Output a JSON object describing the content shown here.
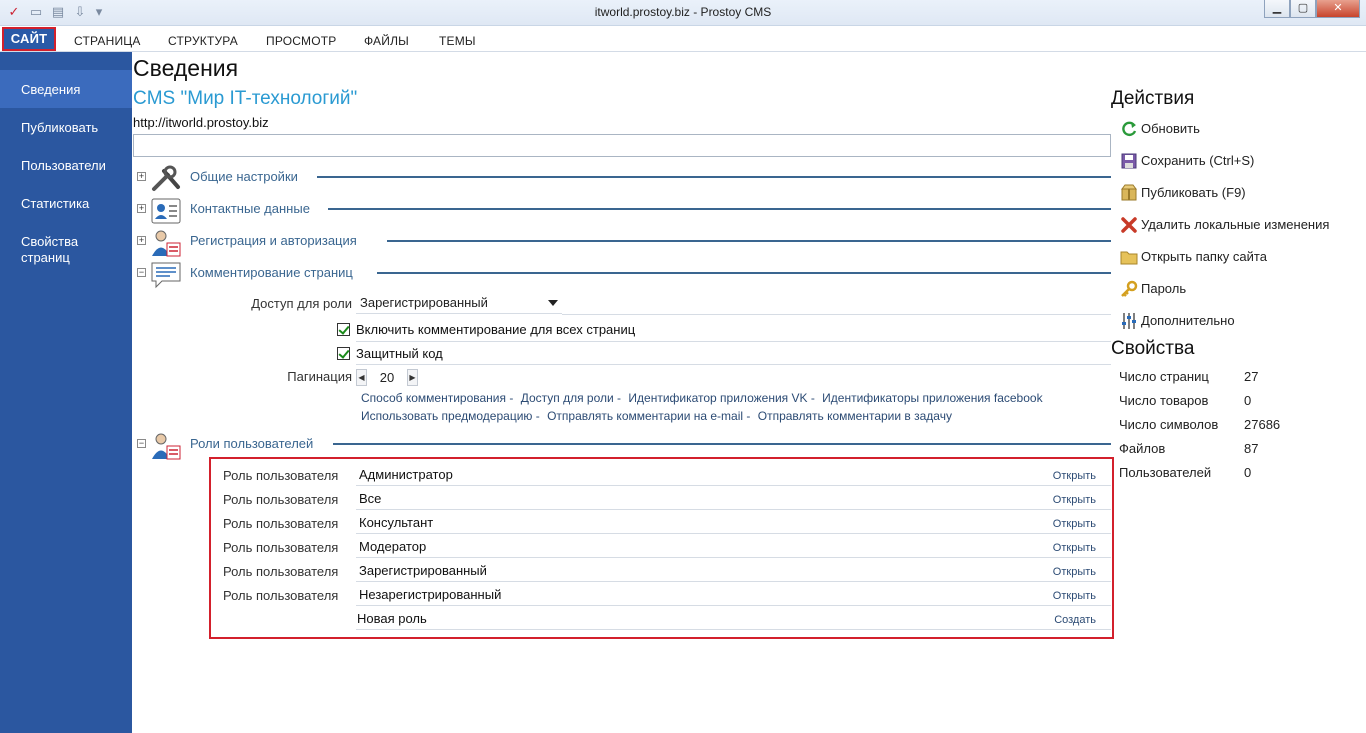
{
  "window": {
    "title": "itworld.prostoy.biz - Prostoy CMS"
  },
  "menu": [
    "САЙТ",
    "СТРАНИЦА",
    "СТРУКТУРА",
    "ПРОСМОТР",
    "ФАЙЛЫ",
    "ТЕМЫ"
  ],
  "sidebar": [
    "Сведения",
    "Публиковать",
    "Пользователи",
    "Статистика",
    "Свойства страниц"
  ],
  "main": {
    "title": "Сведения",
    "site_name": "CMS \"Мир IT-технологий\"",
    "site_url": "http://itworld.prostoy.biz",
    "sections": [
      "Общие настройки",
      "Контактные данные",
      "Регистрация и авторизация",
      "Комментирование страниц",
      "Роли пользователей"
    ],
    "comments": {
      "role_access_label": "Доступ для роли",
      "role_access_value": "Зарегистрированный",
      "enable_all": "Включить комментирование для всех страниц",
      "captcha": "Защитный код",
      "pagination_label": "Пагинация",
      "pagination_value": "20",
      "links_row1": [
        "Способ комментирования -",
        "Доступ для роли -",
        "Идентификатор приложения VK -",
        "Идентификаторы приложения facebook"
      ],
      "links_row2": [
        "Использовать предмодерацию -",
        "Отправлять комментарии на e-mail -",
        "Отправлять комментарии в задачу"
      ]
    },
    "roles": {
      "row_label": "Роль пользователя",
      "open": "Открыть",
      "create": "Создать",
      "new_role": "Новая роль",
      "items": [
        "Администратор",
        "Все",
        "Консультант",
        "Модератор",
        "Зарегистрированный",
        "Незарегистрированный"
      ]
    }
  },
  "actions": {
    "title": "Действия",
    "items": [
      "Обновить",
      "Сохранить (Ctrl+S)",
      "Публиковать (F9)",
      "Удалить локальные изменения",
      "Открыть папку сайта",
      "Пароль",
      "Дополнительно"
    ]
  },
  "properties": {
    "title": "Свойства",
    "items": [
      {
        "label": "Число страниц",
        "value": "27"
      },
      {
        "label": "Число товаров",
        "value": "0"
      },
      {
        "label": "Число символов",
        "value": "27686"
      },
      {
        "label": "Файлов",
        "value": "87"
      },
      {
        "label": "Пользователей",
        "value": "0"
      }
    ]
  }
}
